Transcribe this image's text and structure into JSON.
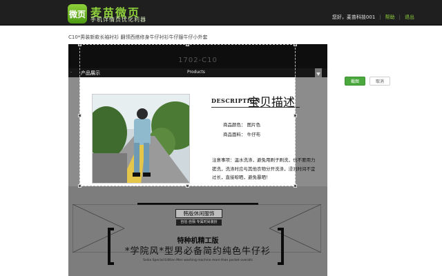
{
  "header": {
    "logo_glyph": "微页",
    "brand": "麦苗微页",
    "brand_sub": "手机详情页优化利器",
    "greeting": "您好，麦苗科技001",
    "help": "帮助",
    "logout": "退出",
    "accent": "#8fd13b"
  },
  "page": {
    "title": "C10*男装新款长袖衬衫 翻领西搭修身牛仔衬衫牛仔服牛仔小外套"
  },
  "actions": {
    "confirm": "截图",
    "cancel": "取消"
  },
  "canvas": {
    "code": "1702-C10",
    "section_cn": "产品展示",
    "section_en": "Products",
    "desc_en": "DESCRIPTION",
    "desc_cn": "宝贝描述",
    "color_label": "商品颜色： 图片色",
    "fabric_label": "商品面料： 牛仔布",
    "note": "注意事项：温水洗涤，避免用刷子刷洗，也不要用力搓洗，洗涤时应与其他衣物分开洗涤，浸泡时间不宜过长，直接晾晒，避免暴晒！",
    "tag": "韩版休闲服饰",
    "tag_sub": "自信·自我·专属时尚装扮",
    "special": "特种机精工版",
    "slogan": "*学院风*型男必备简约纯色牛仔衫",
    "eng_small": "Seiko Special Edition Men washing machine more than pocket overalls"
  }
}
